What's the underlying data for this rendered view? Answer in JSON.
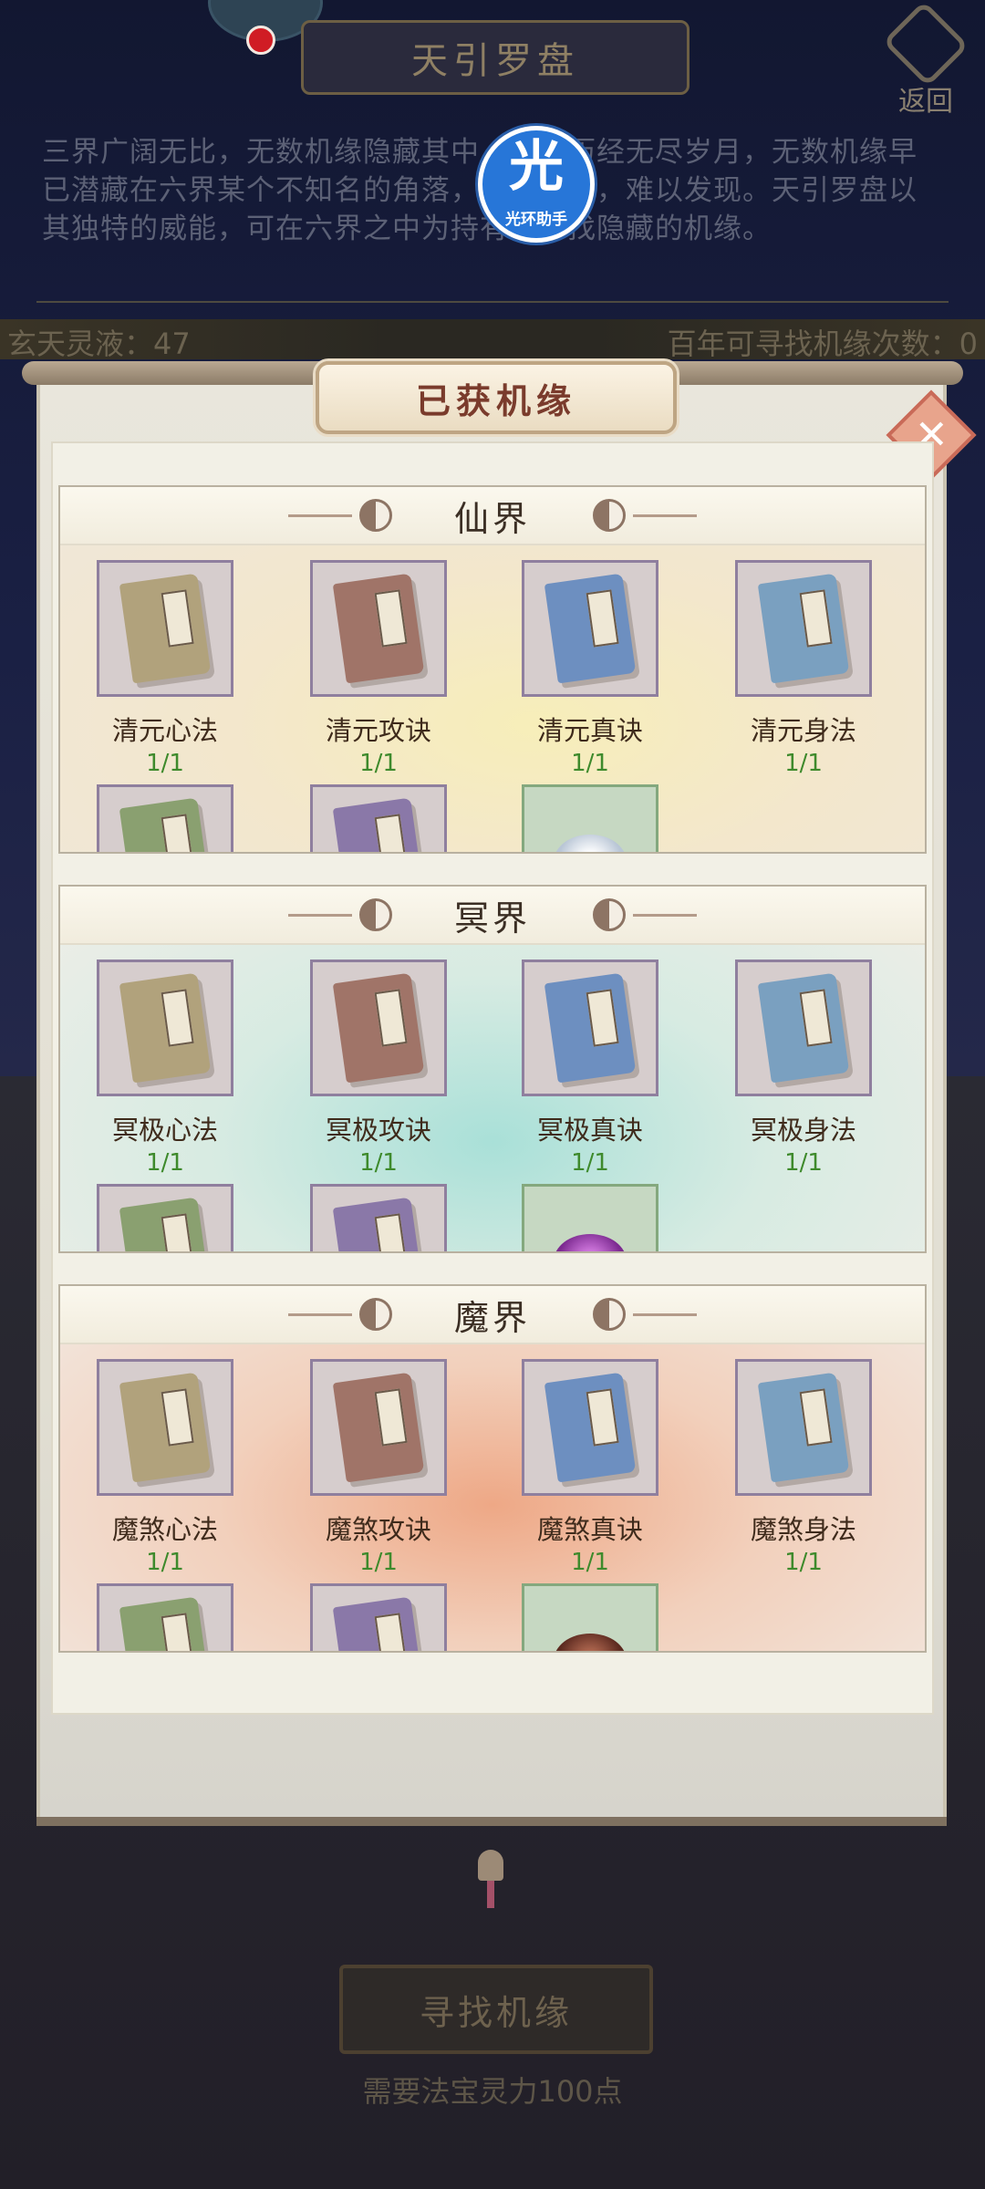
{
  "page": {
    "title": "天引罗盘",
    "back_label": "返回",
    "intro_text": "三界广阔无比，无数机缘隐藏其中，然而历经无尽岁月，无数机缘早已潜藏在六界某个不知名的角落，若无奇遇，难以发现。天引罗盘以其独特的威能，可在六界之中为持有者寻找隐藏的机缘。",
    "resource_left": "玄天灵液：47",
    "resource_right": "百年可寻找机缘次数：0",
    "find_button": "寻找机缘",
    "find_note": "需要法宝灵力100点"
  },
  "overlay_badge": {
    "char": "光",
    "label": "光环助手"
  },
  "modal": {
    "title": "已获机缘",
    "close_glyph": "✕"
  },
  "sections": [
    {
      "title": "仙界",
      "items": [
        {
          "name": "清元心法",
          "count": "1/1"
        },
        {
          "name": "清元攻诀",
          "count": "1/1"
        },
        {
          "name": "清元真诀",
          "count": "1/1"
        },
        {
          "name": "清元身法",
          "count": "1/1"
        }
      ]
    },
    {
      "title": "冥界",
      "items": [
        {
          "name": "冥极心法",
          "count": "1/1"
        },
        {
          "name": "冥极攻诀",
          "count": "1/1"
        },
        {
          "name": "冥极真诀",
          "count": "1/1"
        },
        {
          "name": "冥极身法",
          "count": "1/1"
        }
      ]
    },
    {
      "title": "魔界",
      "items": [
        {
          "name": "魔煞心法",
          "count": "1/1"
        },
        {
          "name": "魔煞攻诀",
          "count": "1/1"
        },
        {
          "name": "魔煞真诀",
          "count": "1/1"
        },
        {
          "name": "魔煞身法",
          "count": "1/1"
        }
      ]
    }
  ],
  "colors": {
    "count_green": "#3e8a2c",
    "title_brown": "#7a3b2c",
    "close_pink": "#e8a48c"
  }
}
